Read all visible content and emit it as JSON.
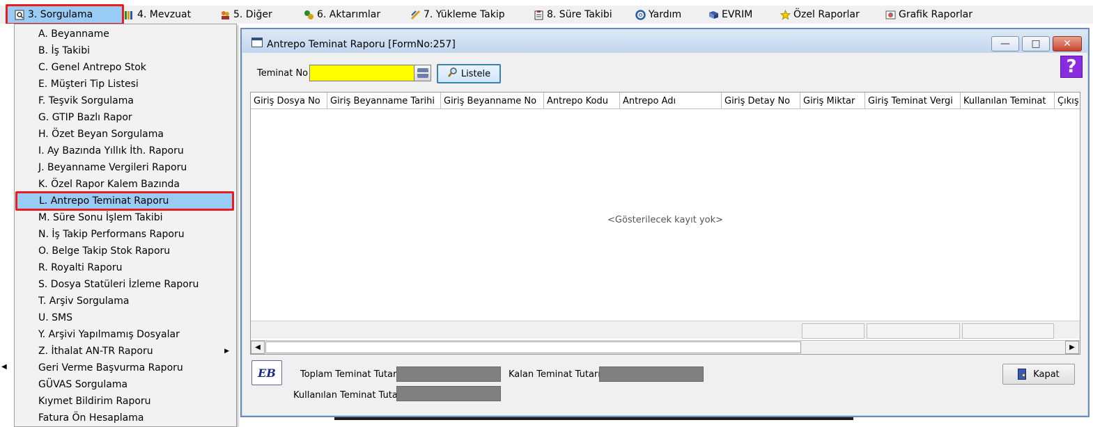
{
  "menubar": {
    "items": [
      {
        "label": "3.  Sorgulama",
        "icon": "magnifier-doc-icon",
        "active": true
      },
      {
        "label": "4.   Mevzuat",
        "icon": "books-icon"
      },
      {
        "label": "5.   Diğer",
        "icon": "people-icon"
      },
      {
        "label": "6.   Aktarımlar",
        "icon": "transfer-icon"
      },
      {
        "label": "7.   Yükleme Takip",
        "icon": "pencil-ruler-icon"
      },
      {
        "label": "8. Süre Takibi",
        "icon": "clipboard-icon"
      },
      {
        "label": "Yardım",
        "icon": "lifebuoy-icon"
      },
      {
        "label": "EVRIM",
        "icon": "book-icon"
      },
      {
        "label": "Özel Raporlar",
        "icon": "star-icon"
      },
      {
        "label": "Grafik Raporlar",
        "icon": "chart-icon"
      }
    ]
  },
  "dropdown": {
    "items": [
      {
        "label": "A.  Beyanname"
      },
      {
        "label": "B.  İş Takibi"
      },
      {
        "label": "C.  Genel Antrepo Stok"
      },
      {
        "label": "E.  Müşteri Tip Listesi"
      },
      {
        "label": "F.  Teşvik Sorgulama"
      },
      {
        "label": "G.  GTIP Bazlı Rapor"
      },
      {
        "label": "H.  Özet Beyan Sorgulama"
      },
      {
        "label": "I.   Ay Bazında Yıllık İth. Raporu"
      },
      {
        "label": "J.   Beyanname Vergileri Raporu"
      },
      {
        "label": "K. Özel Rapor Kalem Bazında"
      },
      {
        "label": "L.  Antrepo Teminat Raporu",
        "selected": true
      },
      {
        "label": "M.  Süre Sonu İşlem Takibi"
      },
      {
        "label": "N.  İş Takip Performans Raporu"
      },
      {
        "label": "O.  Belge Takip Stok Raporu"
      },
      {
        "label": "R.  Royalti Raporu"
      },
      {
        "label": "S.   Dosya Statüleri İzleme Raporu"
      },
      {
        "label": "T.   Arşiv Sorgulama"
      },
      {
        "label": "U.  SMS"
      },
      {
        "label": "Y.  Arşivi Yapılmamış Dosyalar"
      },
      {
        "label": "Z.  İthalat AN-TR Raporu",
        "submenu": true
      },
      {
        "label": "Geri Verme Başvurma Raporu"
      },
      {
        "label": "GÜVAS Sorgulama"
      },
      {
        "label": "Kıymet Bildirim Raporu"
      },
      {
        "label": "Fatura Ön Hesaplama"
      }
    ]
  },
  "window": {
    "title": "Antrepo Teminat Raporu [FormNo:257]",
    "minimize": "—",
    "maximize": "□",
    "close": "✕",
    "help": "?",
    "teminat_label": "Teminat No",
    "teminat_value": "",
    "listele_label": "Listele",
    "grid": {
      "columns": [
        "Giriş Dosya No",
        "Giriş Beyanname Tarihi",
        "Giriş Beyanname No",
        "Antrepo Kodu",
        "Antrepo Adı",
        "Giriş Detay No",
        "Giriş Miktar",
        "Giriş Teminat Vergi",
        "Kullanılan Teminat",
        "Çıkış"
      ],
      "empty_text": "<Gösterilecek kayıt yok>"
    },
    "eb_label": "EB",
    "toplam_label": "Toplam Teminat Tutarı",
    "kalan_label": "Kalan Teminat Tutarı",
    "kullanilan_label": "Kullanılan Teminat Tutarı",
    "kapat_label": "Kapat"
  },
  "colors": {
    "highlight": "#99ccf5",
    "annotation_red": "#e81c1c",
    "input_yellow": "#ffff00",
    "gray_box": "#808080",
    "help_purple": "#8a2be2"
  }
}
